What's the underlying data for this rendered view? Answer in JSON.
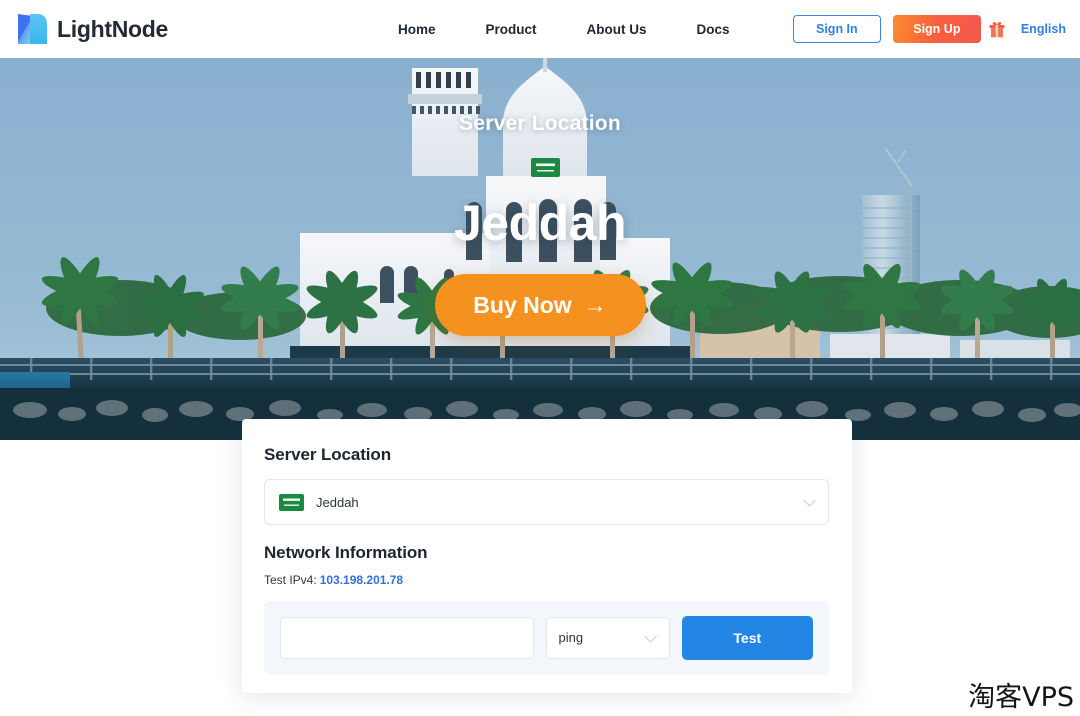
{
  "header": {
    "brand": "LightNode",
    "logo_icon": "lightnode-logo-icon",
    "nav": [
      {
        "label": "Home"
      },
      {
        "label": "Product"
      },
      {
        "label": "About Us"
      },
      {
        "label": "Docs"
      }
    ],
    "sign_in": "Sign In",
    "sign_up": "Sign Up",
    "gift_icon": "gift-icon",
    "language": "English"
  },
  "hero": {
    "subtitle": "Server Location",
    "title": "Jeddah",
    "flag_icon": "saudi-arabia-flag-icon",
    "buy_button": "Buy Now",
    "buy_arrow": "→",
    "scene": "jeddah-waterfront-mosque-photo"
  },
  "card": {
    "server_location_heading": "Server Location",
    "location_select": {
      "value": "Jeddah",
      "flag_icon": "saudi-arabia-flag-icon",
      "chevron_icon": "chevron-down-icon"
    },
    "network_information_heading": "Network Information",
    "test_ipv4_label": "Test IPv4:",
    "test_ipv4_value": "103.198.201.78",
    "test_panel": {
      "input_value": "",
      "input_placeholder": "",
      "method_value": "ping",
      "method_chevron_icon": "chevron-down-icon",
      "test_button": "Test"
    }
  },
  "watermark": "淘客VPS",
  "colors": {
    "brand_dark": "#242a33",
    "accent_blue": "#2f7fe8",
    "signup_gradient_start": "#f98c2e",
    "signup_gradient_end": "#f4574e",
    "buy_orange": "#f5911e",
    "test_blue": "#2486e4",
    "flag_green": "#1a8a40",
    "sky_blue": "#8fb5d3",
    "ip_link_blue": "#2f6fe0"
  }
}
